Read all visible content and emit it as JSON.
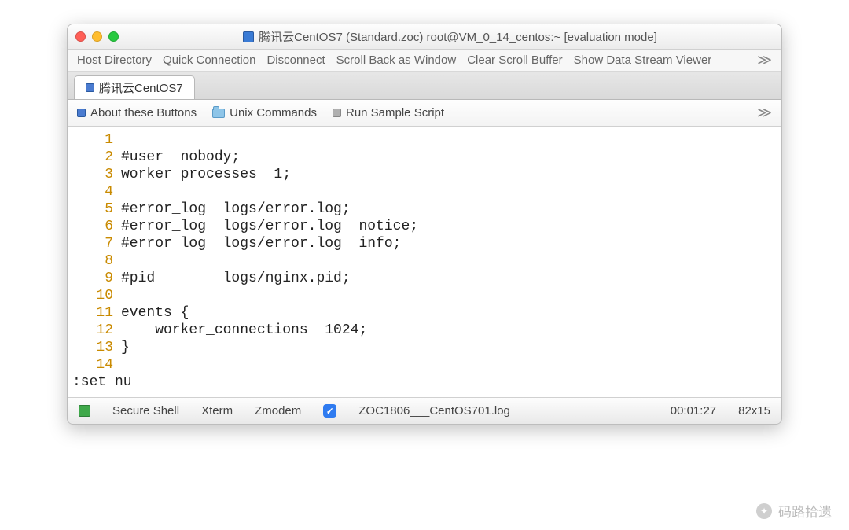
{
  "window": {
    "title": "腾讯云CentOS7 (Standard.zoc) root@VM_0_14_centos:~ [evaluation mode]"
  },
  "menu": {
    "items": [
      "Host Directory",
      "Quick Connection",
      "Disconnect",
      "Scroll Back as Window",
      "Clear Scroll Buffer",
      "Show Data Stream Viewer"
    ],
    "overflow": "≫"
  },
  "tab": {
    "label": "腾讯云CentOS7"
  },
  "toolbar": {
    "about": "About these Buttons",
    "unix": "Unix Commands",
    "sample": "Run Sample Script",
    "overflow": "≫"
  },
  "editor": {
    "lines": [
      {
        "n": "1",
        "t": ""
      },
      {
        "n": "2",
        "t": "#user  nobody;"
      },
      {
        "n": "3",
        "t": "worker_processes  1;"
      },
      {
        "n": "4",
        "t": ""
      },
      {
        "n": "5",
        "t": "#error_log  logs/error.log;"
      },
      {
        "n": "6",
        "t": "#error_log  logs/error.log  notice;"
      },
      {
        "n": "7",
        "t": "#error_log  logs/error.log  info;"
      },
      {
        "n": "8",
        "t": ""
      },
      {
        "n": "9",
        "t": "#pid        logs/nginx.pid;"
      },
      {
        "n": "10",
        "t": ""
      },
      {
        "n": "11",
        "t": "events {"
      },
      {
        "n": "12",
        "t": "    worker_connections  1024;"
      },
      {
        "n": "13",
        "t": "}"
      },
      {
        "n": "14",
        "t": ""
      }
    ],
    "command": ":set nu"
  },
  "status": {
    "conn": "Secure Shell",
    "term": "Xterm",
    "proto": "Zmodem",
    "logfile": "ZOC1806___CentOS701.log",
    "time": "00:01:27",
    "size": "82x15"
  },
  "watermark": {
    "text": "码路拾遗"
  }
}
